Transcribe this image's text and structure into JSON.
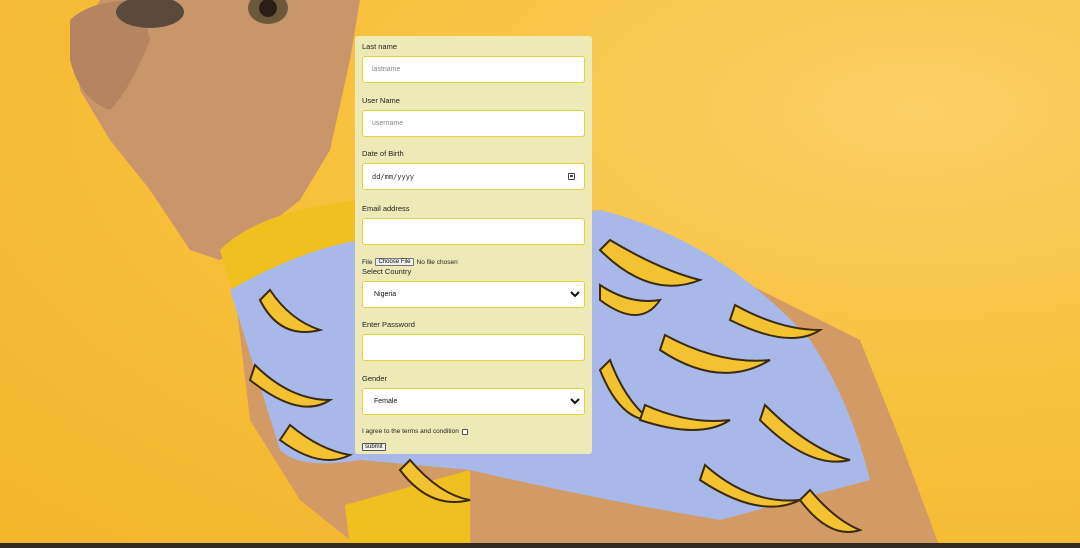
{
  "form": {
    "last_name": {
      "label": "Last name",
      "placeholder": "lastname"
    },
    "user_name": {
      "label": "User Name",
      "placeholder": "username"
    },
    "dob": {
      "label": "Date of Birth",
      "placeholder": "dd/mm/yyyy"
    },
    "email": {
      "label": "Email address",
      "value": ""
    },
    "file": {
      "label": "File",
      "button": "Choose File",
      "status": "No file chosen"
    },
    "country": {
      "label": "Select Country",
      "selected": "Nigeria"
    },
    "password": {
      "label": "Enter Password",
      "value": ""
    },
    "gender": {
      "label": "Gender",
      "selected": "Female"
    },
    "terms": {
      "label": "I agree to the terms and condition",
      "checked": false
    },
    "submit_label": "submit"
  },
  "colors": {
    "background": "#f7c13e",
    "card": "#eeeab8",
    "field_border": "#e6d23a",
    "shirt": "#a8b8e8",
    "banana": "#f2c230"
  }
}
